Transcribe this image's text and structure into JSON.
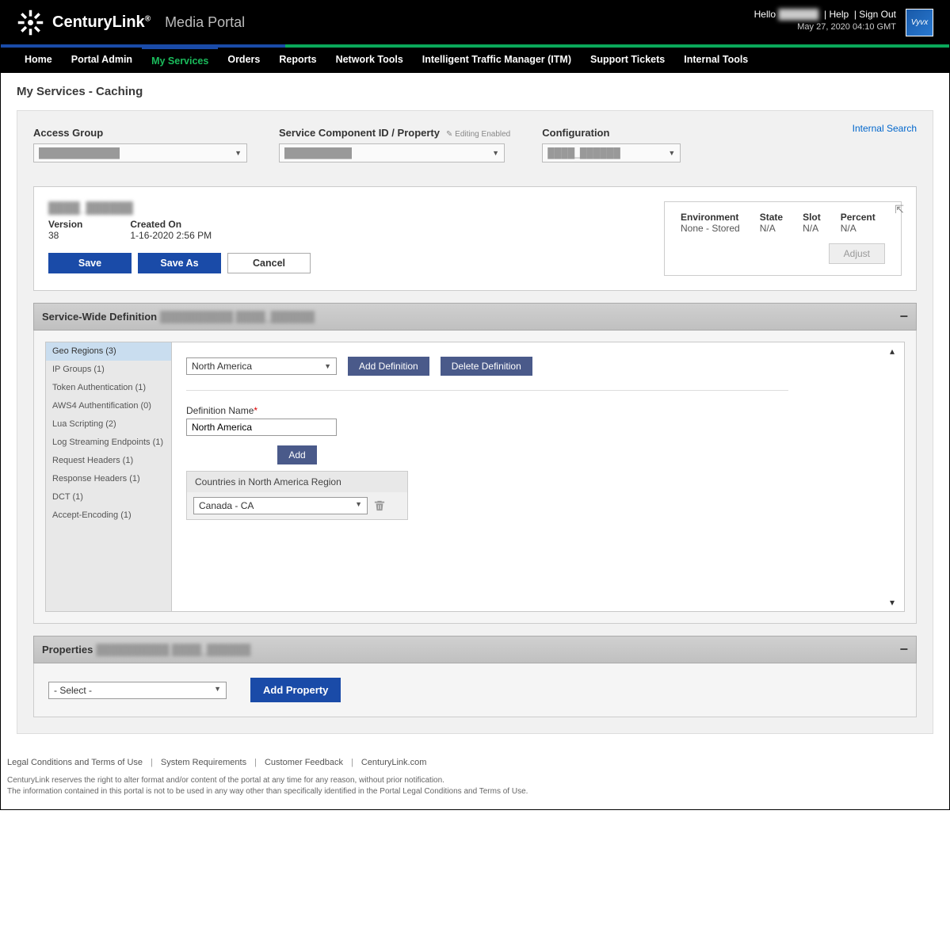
{
  "header": {
    "brand": "CenturyLink",
    "portal": "Media Portal",
    "greeting": "Hello",
    "username": "██████",
    "help": "Help",
    "signout": "Sign Out",
    "date": "May 27, 2020 04:10 GMT",
    "badge": "Vyvx"
  },
  "nav": {
    "items": [
      "Home",
      "Portal Admin",
      "My Services",
      "Orders",
      "Reports",
      "Network Tools",
      "Intelligent Traffic Manager (ITM)",
      "Support Tickets",
      "Internal Tools"
    ],
    "active": "My Services"
  },
  "page_title": "My Services - Caching",
  "filters": {
    "access_group": {
      "label": "Access Group",
      "value": "████████████"
    },
    "scid": {
      "label": "Service Component ID / Property",
      "editing": "Editing Enabled",
      "value": "██████████"
    },
    "configuration": {
      "label": "Configuration",
      "value": "████_██████"
    },
    "internal_search": "Internal Search"
  },
  "config_panel": {
    "title": "████_██████",
    "version_label": "Version",
    "version": "38",
    "created_label": "Created On",
    "created": "1-16-2020 2:56 PM",
    "save": "Save",
    "save_as": "Save As",
    "cancel": "Cancel",
    "env": {
      "environment_label": "Environment",
      "environment": "None - Stored",
      "state_label": "State",
      "state": "N/A",
      "slot_label": "Slot",
      "slot": "N/A",
      "percent_label": "Percent",
      "percent": "N/A",
      "adjust": "Adjust"
    }
  },
  "swd": {
    "title": "Service-Wide Definition",
    "subtitle": "██████████  ████_██████",
    "sidebar": [
      "Geo Regions (3)",
      "IP Groups (1)",
      "Token Authentication (1)",
      "AWS4 Authentification (0)",
      "Lua Scripting (2)",
      "Log Streaming Endpoints (1)",
      "Request Headers (1)",
      "Response Headers (1)",
      "DCT (1)",
      "Accept-Encoding (1)"
    ],
    "region_select": "North America",
    "add_definition": "Add Definition",
    "delete_definition": "Delete Definition",
    "def_name_label": "Definition Name",
    "def_name_value": "North America",
    "add": "Add",
    "region_box_title": "Countries in North America Region",
    "country": "Canada - CA"
  },
  "properties": {
    "title": "Properties",
    "subtitle": "██████████  ████_██████",
    "select": "- Select -",
    "add": "Add Property"
  },
  "footer": {
    "links": [
      "Legal Conditions and Terms of Use",
      "System Requirements",
      "Customer Feedback",
      "CenturyLink.com"
    ],
    "disclaimer1": "CenturyLink reserves the right to alter format and/or content of the portal at any time for any reason, without prior notification.",
    "disclaimer2": "The information contained in this portal is not to be used in any way other than specifically identified in the Portal Legal Conditions and Terms of Use."
  }
}
